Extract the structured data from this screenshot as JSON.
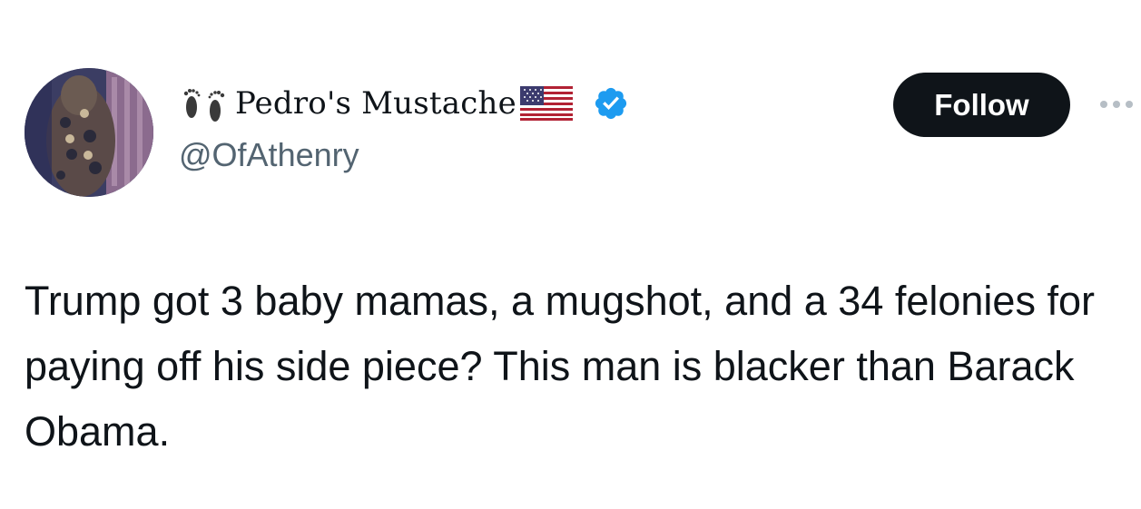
{
  "author": {
    "display_name": "Pedro's Mustache",
    "handle": "@OfAthenry",
    "icons": [
      "footprints-icon",
      "us-flag-icon",
      "verified-badge-icon"
    ],
    "verified_color": "#1d9bf0"
  },
  "actions": {
    "follow_label": "Follow",
    "more_icon": "more-options-icon"
  },
  "tweet": {
    "text": "Trump got 3 baby mamas, a mugshot, and a 34 felonies for paying off his side piece? This man is blacker than Barack Obama."
  },
  "colors": {
    "text_primary": "#0f1419",
    "text_secondary": "#536471",
    "follow_bg": "#0f1419",
    "follow_text": "#ffffff"
  }
}
